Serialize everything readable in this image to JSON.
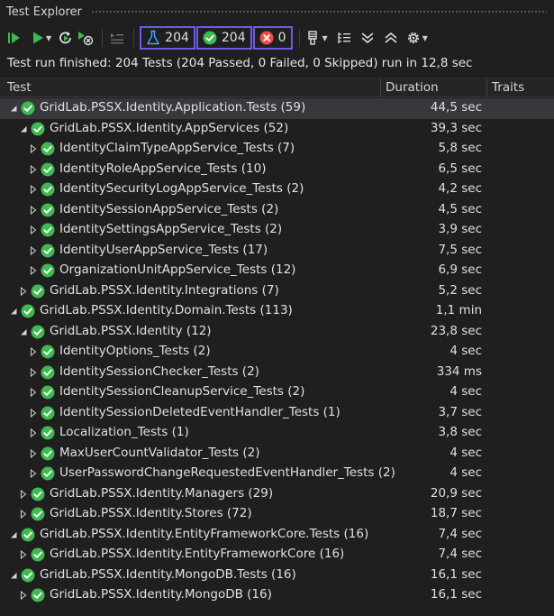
{
  "window": {
    "title": "Test Explorer"
  },
  "toolbar": {
    "total_count": "204",
    "passed_count": "204",
    "failed_count": "0",
    "icons": [
      "run-all-icon",
      "run-icon",
      "rerun-icon",
      "cancel-icon",
      "playlist-icon",
      "flask-icon",
      "pass-icon",
      "fail-icon",
      "analyze-icon",
      "group-by-icon",
      "expand-all-icon",
      "collapse-all-icon",
      "settings-icon"
    ]
  },
  "status": {
    "text": "Test run finished: 204 Tests (204 Passed, 0 Failed, 0 Skipped) run in 12,8 sec"
  },
  "columns": {
    "test": "Test",
    "duration": "Duration",
    "traits": "Traits"
  },
  "colors": {
    "accent": "#6b5ce7",
    "pass": "#3fb950",
    "fail": "#f14c4c",
    "flask": "#4aa3ff"
  },
  "rows": [
    {
      "name": "GridLab.PSSX.Identity.Application.Tests (59)",
      "duration": "44,5 sec",
      "level": 0,
      "expanded": true,
      "selected": true
    },
    {
      "name": "GridLab.PSSX.Identity.AppServices (52)",
      "duration": "39,3 sec",
      "level": 1,
      "expanded": true
    },
    {
      "name": "IdentityClaimTypeAppService_Tests (7)",
      "duration": "5,8 sec",
      "level": 2,
      "expanded": false
    },
    {
      "name": "IdentityRoleAppService_Tests (10)",
      "duration": "6,5 sec",
      "level": 2,
      "expanded": false
    },
    {
      "name": "IdentitySecurityLogAppService_Tests (2)",
      "duration": "4,2 sec",
      "level": 2,
      "expanded": false
    },
    {
      "name": "IdentitySessionAppService_Tests (2)",
      "duration": "4,5 sec",
      "level": 2,
      "expanded": false
    },
    {
      "name": "IdentitySettingsAppService_Tests (2)",
      "duration": "3,9 sec",
      "level": 2,
      "expanded": false
    },
    {
      "name": "IdentityUserAppService_Tests (17)",
      "duration": "7,5 sec",
      "level": 2,
      "expanded": false
    },
    {
      "name": "OrganizationUnitAppService_Tests (12)",
      "duration": "6,9 sec",
      "level": 2,
      "expanded": false
    },
    {
      "name": "GridLab.PSSX.Identity.Integrations (7)",
      "duration": "5,2 sec",
      "level": 1,
      "expanded": false
    },
    {
      "name": "GridLab.PSSX.Identity.Domain.Tests (113)",
      "duration": "1,1 min",
      "level": 0,
      "expanded": true
    },
    {
      "name": "GridLab.PSSX.Identity (12)",
      "duration": "23,8 sec",
      "level": 1,
      "expanded": true
    },
    {
      "name": "IdentityOptions_Tests (2)",
      "duration": "4 sec",
      "level": 2,
      "expanded": false
    },
    {
      "name": "IdentitySessionChecker_Tests (2)",
      "duration": "334 ms",
      "level": 2,
      "expanded": false
    },
    {
      "name": "IdentitySessionCleanupService_Tests (2)",
      "duration": "4 sec",
      "level": 2,
      "expanded": false
    },
    {
      "name": "IdentitySessionDeletedEventHandler_Tests (1)",
      "duration": "3,7 sec",
      "level": 2,
      "expanded": false
    },
    {
      "name": "Localization_Tests (1)",
      "duration": "3,8 sec",
      "level": 2,
      "expanded": false
    },
    {
      "name": "MaxUserCountValidator_Tests (2)",
      "duration": "4 sec",
      "level": 2,
      "expanded": false
    },
    {
      "name": "UserPasswordChangeRequestedEventHandler_Tests (2)",
      "duration": "4 sec",
      "level": 2,
      "expanded": false
    },
    {
      "name": "GridLab.PSSX.Identity.Managers (29)",
      "duration": "20,9 sec",
      "level": 1,
      "expanded": false
    },
    {
      "name": "GridLab.PSSX.Identity.Stores (72)",
      "duration": "18,7 sec",
      "level": 1,
      "expanded": false
    },
    {
      "name": "GridLab.PSSX.Identity.EntityFrameworkCore.Tests (16)",
      "duration": "7,4 sec",
      "level": 0,
      "expanded": true
    },
    {
      "name": "GridLab.PSSX.Identity.EntityFrameworkCore (16)",
      "duration": "7,4 sec",
      "level": 1,
      "expanded": false
    },
    {
      "name": "GridLab.PSSX.Identity.MongoDB.Tests (16)",
      "duration": "16,1 sec",
      "level": 0,
      "expanded": true
    },
    {
      "name": "GridLab.PSSX.Identity.MongoDB (16)",
      "duration": "16,1 sec",
      "level": 1,
      "expanded": false
    }
  ]
}
